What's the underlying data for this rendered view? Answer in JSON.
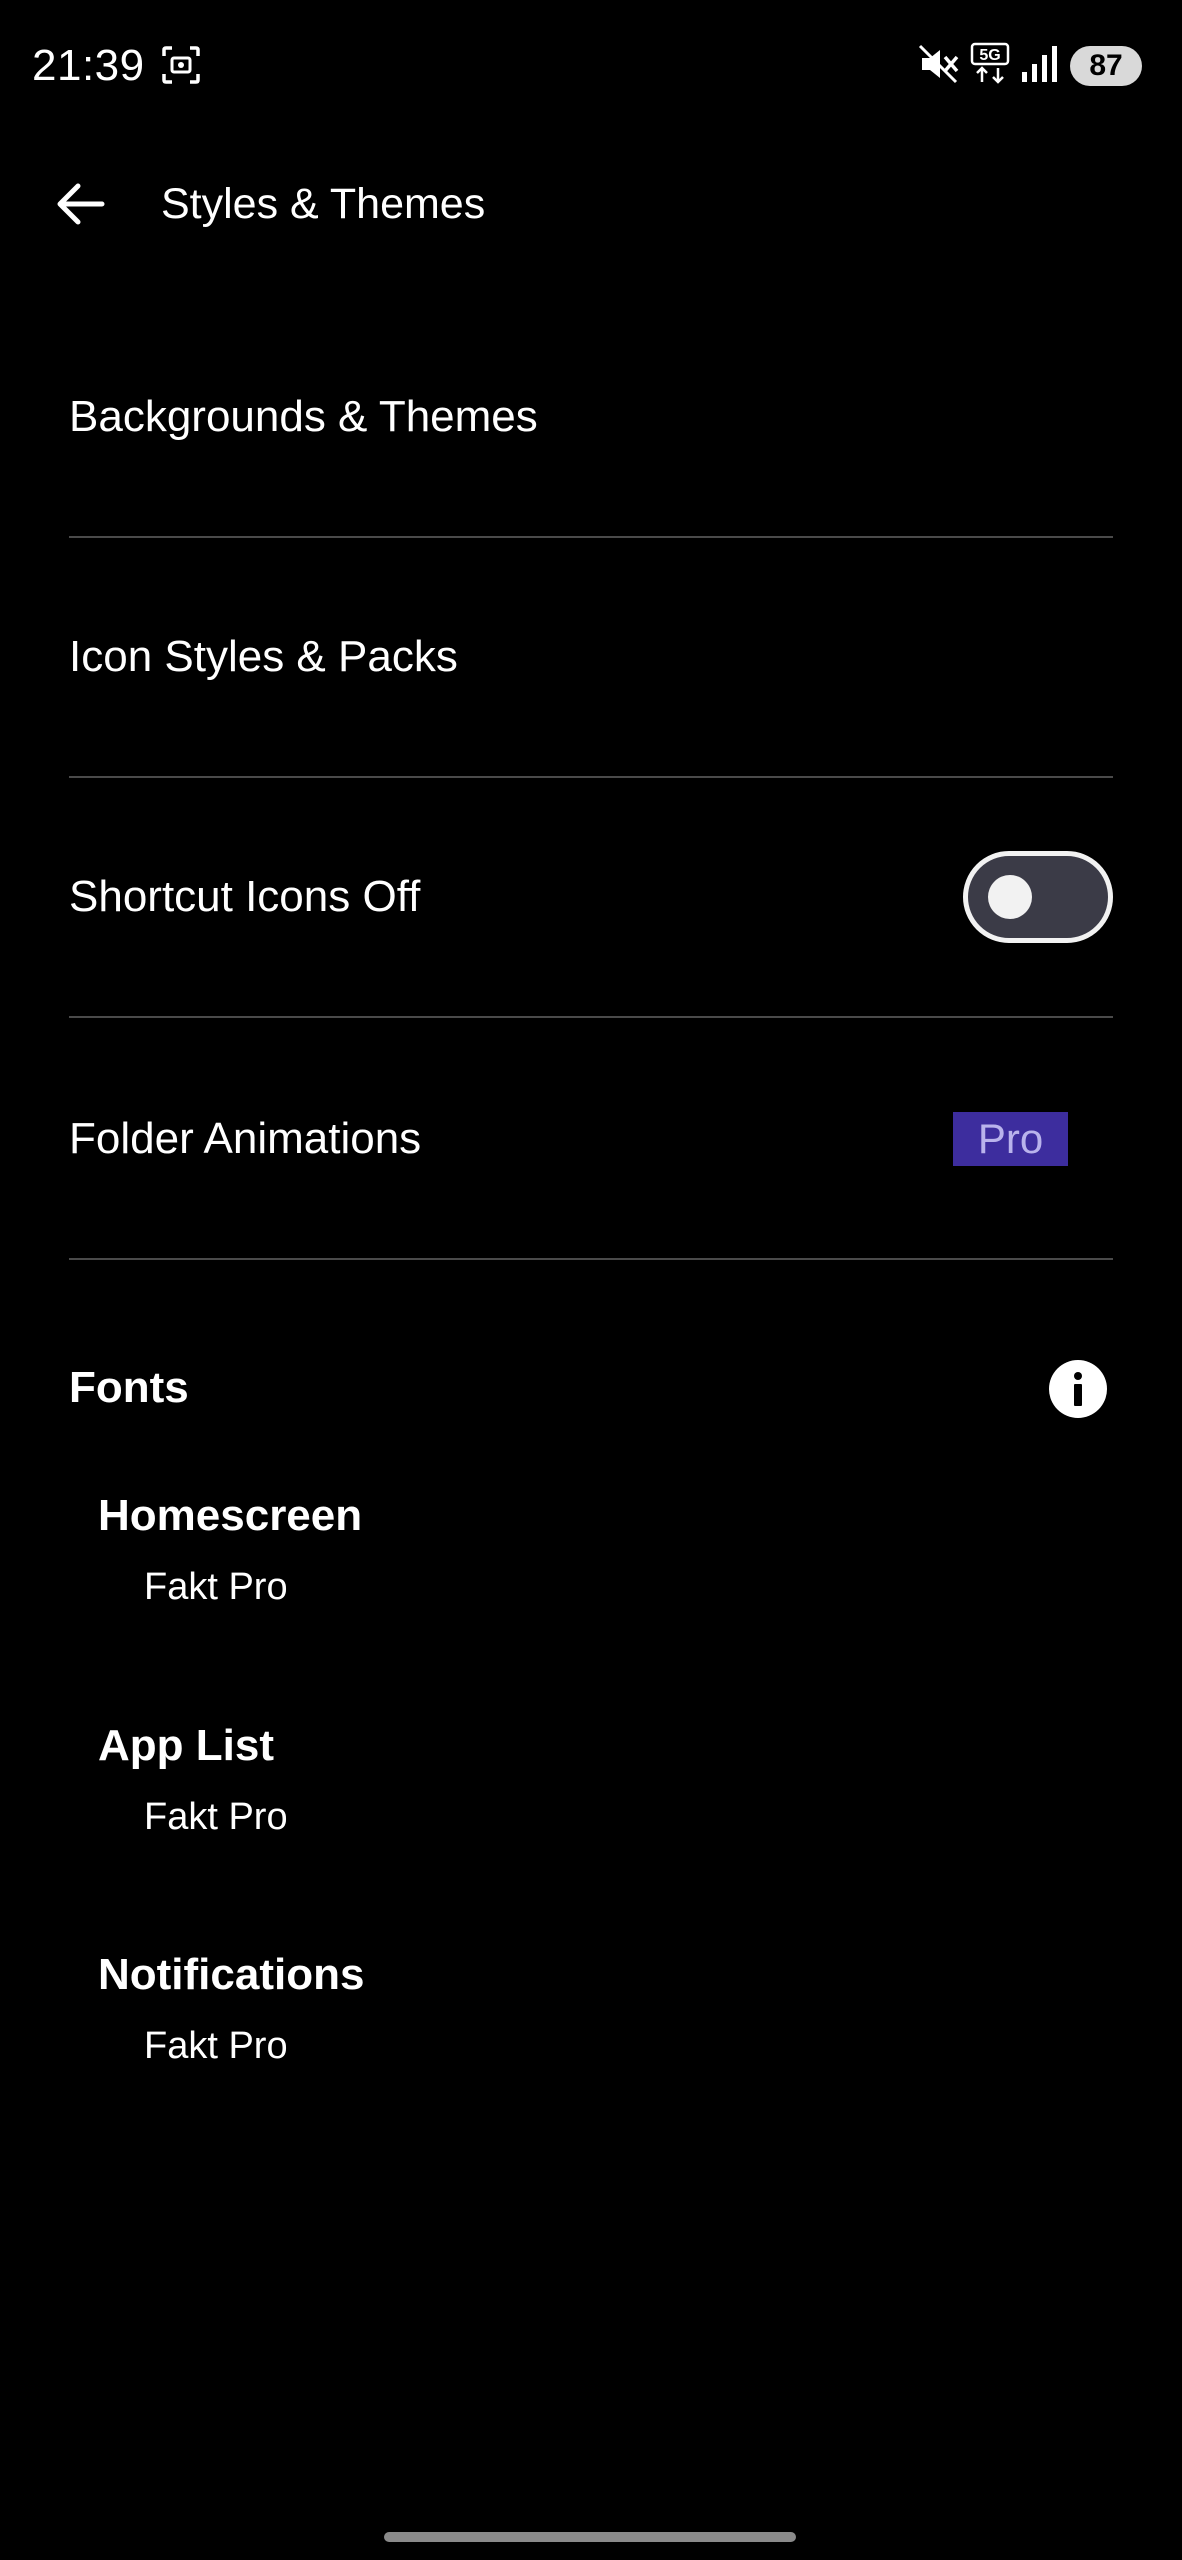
{
  "status_bar": {
    "time": "21:39",
    "battery": "87",
    "icons": [
      "screenshot-icon",
      "mute-icon",
      "5g-icon",
      "signal-icon",
      "battery-icon"
    ]
  },
  "app_bar": {
    "back_icon": "arrow-left-icon",
    "title": "Styles & Themes"
  },
  "settings": {
    "backgrounds_label": "Backgrounds & Themes",
    "icon_styles_label": "Icon Styles & Packs",
    "shortcut_icons_label": "Shortcut Icons Off",
    "shortcut_icons_toggle_on": false,
    "folder_animations_label": "Folder Animations",
    "folder_animations_badge": "Pro"
  },
  "fonts": {
    "section_title": "Fonts",
    "info_icon": "info-icon",
    "items": [
      {
        "title": "Homescreen",
        "value": "Fakt Pro"
      },
      {
        "title": "App List",
        "value": "Fakt Pro"
      },
      {
        "title": "Notifications",
        "value": "Fakt Pro"
      }
    ]
  },
  "colors": {
    "background": "#000000",
    "divider": "#4a4a4a",
    "pro_badge_bg": "#3d2d9e",
    "pro_badge_text": "#b9b3ec",
    "toggle_track": "#3b3b47"
  }
}
